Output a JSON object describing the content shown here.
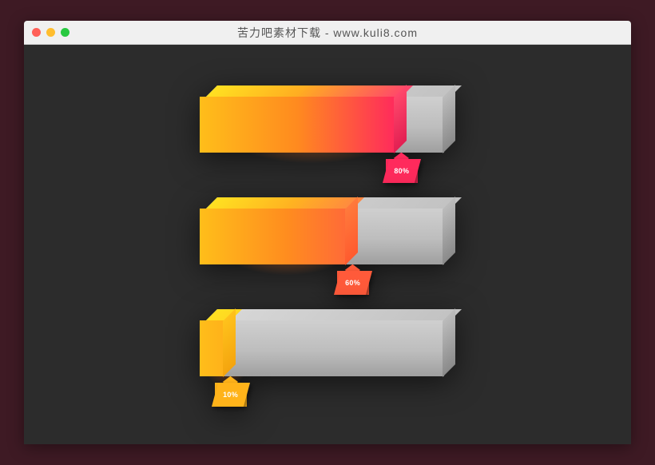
{
  "window": {
    "title": "苦力吧素材下载 - www.kuli8.com"
  },
  "chart_data": {
    "type": "bar",
    "title": "",
    "xlabel": "",
    "ylabel": "",
    "ylim": [
      0,
      100
    ],
    "series": [
      {
        "name": "bar-1",
        "value": 80,
        "label": "80%"
      },
      {
        "name": "bar-2",
        "value": 60,
        "label": "60%"
      },
      {
        "name": "bar-3",
        "value": 10,
        "label": "10%"
      }
    ]
  },
  "colors": {
    "fill_gradient_start": "#ffbe1a",
    "fill_gradient_end": "#ff2a5c",
    "track": "#bdbdbd",
    "flag_80": "#ff2a5c",
    "flag_60": "#ff5a3a",
    "flag_10": "#ffb31a"
  }
}
